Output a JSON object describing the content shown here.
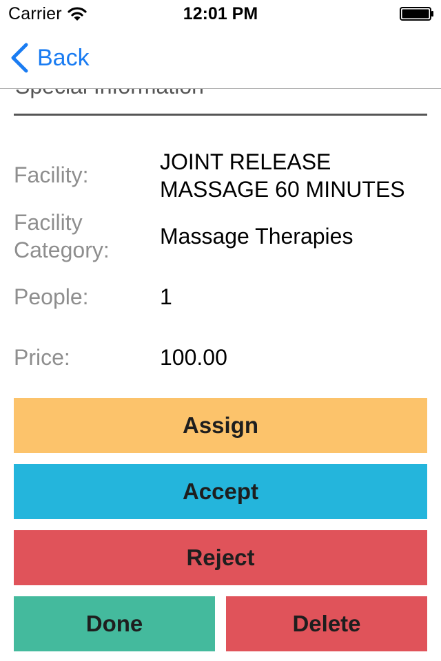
{
  "status_bar": {
    "carrier": "Carrier",
    "time": "12:01 PM",
    "wifi_icon": "wifi-icon",
    "battery_icon": "battery-full-icon"
  },
  "nav": {
    "back_label": "Back",
    "back_icon": "chevron-left-icon",
    "accent_color": "#1a7cf2"
  },
  "form": {
    "special_information": "Special Information"
  },
  "details": {
    "facility_label": "Facility:",
    "facility_value_line1": "JOINT RELEASE",
    "facility_value_line2": "MASSAGE 60 MINUTES",
    "category_label_line1": "Facility",
    "category_label_line2": "Category:",
    "category_value": "Massage Therapies",
    "people_label": "People:",
    "people_value": "1",
    "price_label": "Price:",
    "price_value": "100.00"
  },
  "actions": {
    "assign": {
      "label": "Assign",
      "color": "#fcc36b"
    },
    "accept": {
      "label": "Accept",
      "color": "#24b5dc"
    },
    "reject": {
      "label": "Reject",
      "color": "#e0535a"
    },
    "done": {
      "label": "Done",
      "color": "#44ba9d"
    },
    "delete": {
      "label": "Delete",
      "color": "#e0535a"
    }
  }
}
